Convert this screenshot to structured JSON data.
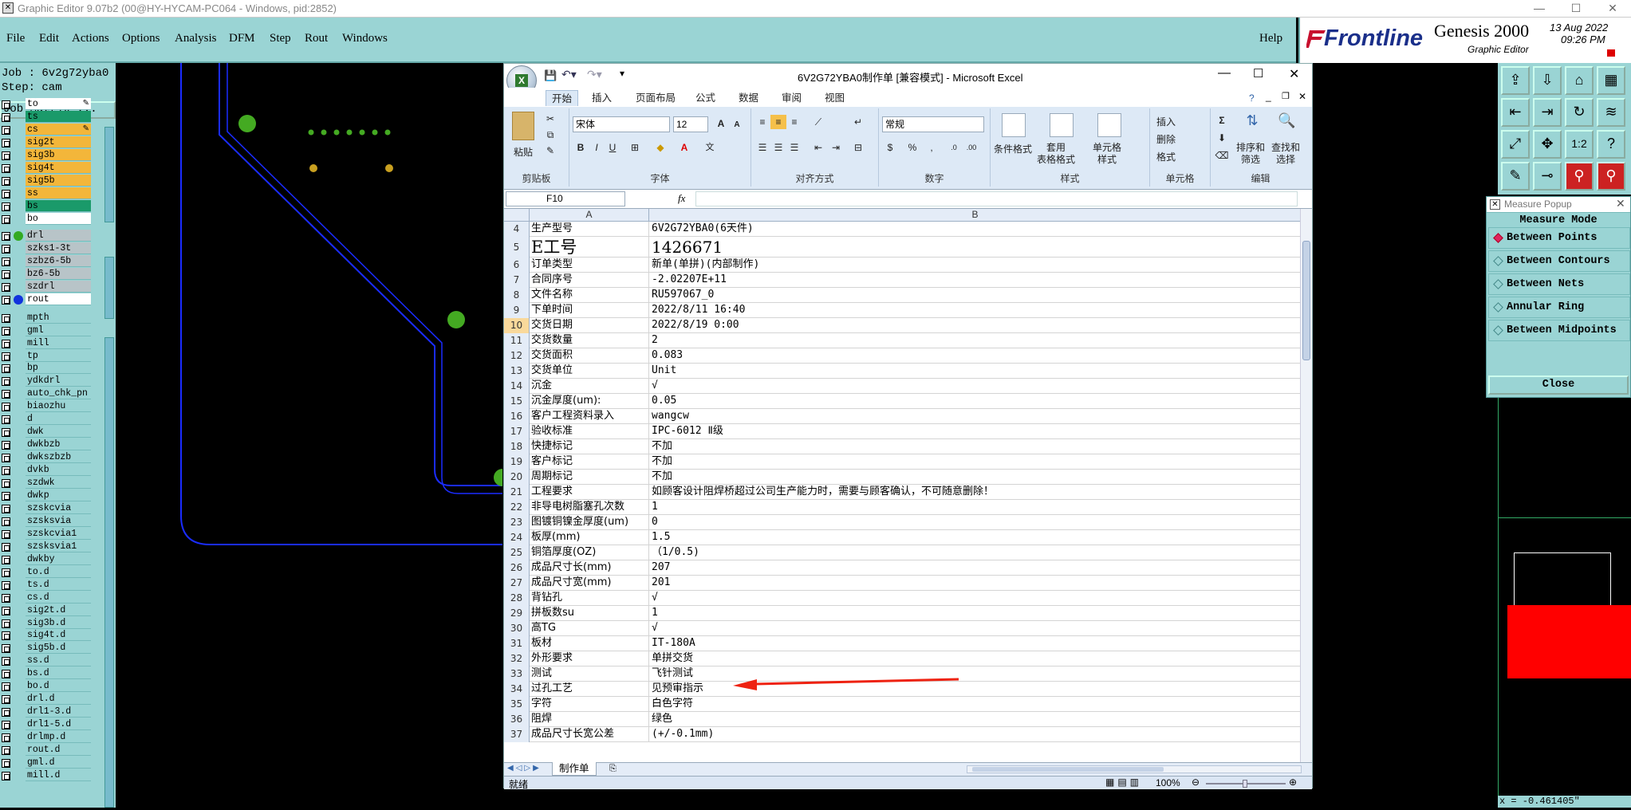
{
  "genesis": {
    "window_title": "Graphic Editor 9.07b2 (00@HY-HYCAM-PC064 - Windows, pid:2852)",
    "menu": [
      "File",
      "Edit",
      "Actions",
      "Options",
      "Analysis",
      "DFM",
      "Step",
      "Rout",
      "Windows"
    ],
    "help": "Help",
    "brand": "Frontline",
    "product": "Genesis 2000",
    "subtitle": "Graphic Editor",
    "date": "13 Aug 2022",
    "time": "09:26 PM",
    "job_label": "Job : 6v2g72yba0",
    "step_label": "Step: cam",
    "job_matrix_button": "Job Matrix ...",
    "layers_top": [
      {
        "name": "to",
        "color": "#ffffff",
        "icon": "pen"
      },
      {
        "name": "ts",
        "color": "#1a9a6a"
      },
      {
        "name": "cs",
        "color": "#f3b63a",
        "icon": "pen"
      },
      {
        "name": "sig2t",
        "color": "#f3b63a"
      },
      {
        "name": "sig3b",
        "color": "#f3b63a"
      },
      {
        "name": "sig4t",
        "color": "#f3b63a"
      },
      {
        "name": "sig5b",
        "color": "#f3b63a"
      },
      {
        "name": "ss",
        "color": "#f3b63a"
      },
      {
        "name": "bs",
        "color": "#1a9a6a"
      },
      {
        "name": "bo",
        "color": "#ffffff"
      }
    ],
    "layers_drill": [
      {
        "name": "drl",
        "color": "#b8c4c8",
        "dot": "#33aa22",
        "selected": true
      },
      {
        "name": "szks1-3t",
        "color": "#b8c4c8"
      },
      {
        "name": "szbz6-5b",
        "color": "#b8c4c8"
      },
      {
        "name": "bz6-5b",
        "color": "#b8c4c8"
      },
      {
        "name": "szdrl",
        "color": "#b8c4c8"
      },
      {
        "name": "rout",
        "color": "#ffffff",
        "dot": "#1133dd"
      }
    ],
    "layers_misc": [
      "mpth",
      "gml",
      "mill",
      "tp",
      "bp",
      "ydkdrl",
      "auto_chk_pn",
      "biaozhu",
      "d",
      "dwk",
      "dwkbzb",
      "dwkszbzb",
      "dvkb",
      "szdwk",
      "dwkp",
      "szskcvia",
      "szsksvia",
      "szskcvia1",
      "szsksvia1",
      "dwkby",
      "to.d",
      "ts.d",
      "cs.d",
      "sig2t.d",
      "sig3b.d",
      "sig4t.d",
      "sig5b.d",
      "ss.d",
      "bs.d",
      "bo.d",
      "drl.d",
      "drl1-3.d",
      "drl1-5.d",
      "drlmp.d",
      "rout.d",
      "gml.d",
      "mill.d"
    ],
    "measure": {
      "title": "Measure Popup",
      "mode_label": "Measure Mode",
      "options": [
        "Between Points",
        "Between Contours",
        "Between Nets",
        "Annular Ring",
        "Between Midpoints"
      ],
      "close": "Close"
    },
    "coord_readout": "x = -0.461405\""
  },
  "excel": {
    "title": "6V2G72YBA0制作单  [兼容模式] - Microsoft Excel",
    "tabs": [
      "开始",
      "插入",
      "页面布局",
      "公式",
      "数据",
      "审阅",
      "视图"
    ],
    "groups": {
      "clipboard": "剪贴板",
      "font": "字体",
      "align": "对齐方式",
      "number": "数字",
      "style": "样式",
      "cells": "单元格",
      "edit": "编辑"
    },
    "paste": "粘贴",
    "font_name": "宋体",
    "font_size": "12",
    "number_format": "常规",
    "style_buttons": [
      "条件格式",
      "套用\n表格格式",
      "单元格\n样式"
    ],
    "cell_buttons": [
      "插入",
      "删除",
      "格式"
    ],
    "edit_buttons": [
      "排序和\n筛选",
      "查找和\n选择"
    ],
    "name_box": "F10",
    "fx": "fx",
    "col_a": "A",
    "col_b": "B",
    "rows": [
      {
        "n": "4",
        "a": "生产型号",
        "b": "6V2G72YBA0(6天件)"
      },
      {
        "n": "5",
        "a": "E工号",
        "b": "1426671",
        "big": true
      },
      {
        "n": "6",
        "a": "订单类型",
        "b": "新单(单拼)(内部制作)"
      },
      {
        "n": "7",
        "a": "合同序号",
        "b": "-2.02207E+11"
      },
      {
        "n": "8",
        "a": "文件名称",
        "b": "RU597067_0"
      },
      {
        "n": "9",
        "a": "下单时间",
        "b": "2022/8/11 16:40"
      },
      {
        "n": "10",
        "a": "交货日期",
        "b": "2022/8/19 0:00",
        "sel": true
      },
      {
        "n": "11",
        "a": "交货数量",
        "b": "2"
      },
      {
        "n": "12",
        "a": "交货面积",
        "b": "0.083"
      },
      {
        "n": "13",
        "a": "交货单位",
        "b": "Unit"
      },
      {
        "n": "14",
        "a": "沉金",
        "b": "√"
      },
      {
        "n": "15",
        "a": "沉金厚度(um):",
        "b": "0.05"
      },
      {
        "n": "16",
        "a": "客户工程资料录入",
        "b": "wangcw"
      },
      {
        "n": "17",
        "a": "验收标准",
        "b": "IPC-6012 Ⅱ级"
      },
      {
        "n": "18",
        "a": "快捷标记",
        "b": "不加"
      },
      {
        "n": "19",
        "a": "客户标记",
        "b": "不加"
      },
      {
        "n": "20",
        "a": "周期标记",
        "b": "不加"
      },
      {
        "n": "21",
        "a": "工程要求",
        "b": "如顾客设计阻焊桥超过公司生产能力时，需要与顾客确认，不可随意删除！"
      },
      {
        "n": "22",
        "a": "非导电树脂塞孔次数",
        "b": "1"
      },
      {
        "n": "23",
        "a": "图镀铜镍金厚度(um)",
        "b": "0"
      },
      {
        "n": "24",
        "a": "板厚(mm)",
        "b": "1.5"
      },
      {
        "n": "25",
        "a": "铜箔厚度(OZ)",
        "b": "（1/0.5)"
      },
      {
        "n": "26",
        "a": "成品尺寸长(mm)",
        "b": "207"
      },
      {
        "n": "27",
        "a": "成品尺寸宽(mm)",
        "b": "201"
      },
      {
        "n": "28",
        "a": "背钻孔",
        "b": "√"
      },
      {
        "n": "29",
        "a": "拼板数su",
        "b": "1"
      },
      {
        "n": "30",
        "a": "高TG",
        "b": "√"
      },
      {
        "n": "31",
        "a": "板材",
        "b": "IT-180A"
      },
      {
        "n": "32",
        "a": "外形要求",
        "b": "单拼交货"
      },
      {
        "n": "33",
        "a": "测试",
        "b": "飞针测试"
      },
      {
        "n": "34",
        "a": "过孔工艺",
        "b": "见预审指示"
      },
      {
        "n": "35",
        "a": "字符",
        "b": "白色字符"
      },
      {
        "n": "36",
        "a": "阻焊",
        "b": "绿色"
      },
      {
        "n": "37",
        "a": "成品尺寸长宽公差",
        "b": "(+/-0.1mm)"
      }
    ],
    "sheet_tab": "制作单",
    "status_ready": "就绪",
    "zoom": "100%"
  }
}
